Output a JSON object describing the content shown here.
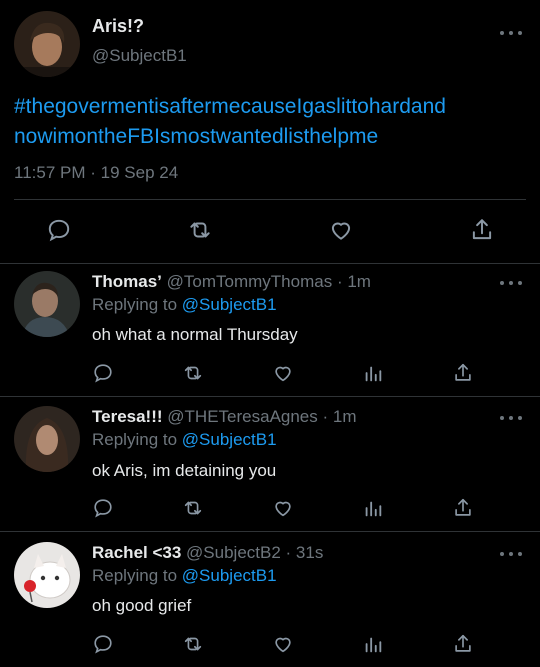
{
  "main_tweet": {
    "display_name": "Aris!?",
    "handle": "@SubjectB1",
    "text_line1": "#thegovermentisaftermecauseIgaslittohardand",
    "text_line2": "nowimontheFBIsmostwantedlisthelpme",
    "time": "11:57 PM",
    "sep": "·",
    "date": "19 Sep 24"
  },
  "replies": [
    {
      "display_name": "Thomas’",
      "handle": "@TomTommyThomas",
      "age": "· 1m",
      "replying_prefix": "Replying to",
      "replying_to": "@SubjectB1",
      "text": "oh what a normal Thursday"
    },
    {
      "display_name": "Teresa!!!",
      "handle": "@THETeresaAgnes",
      "age": "· 1m",
      "replying_prefix": "Replying to",
      "replying_to": "@SubjectB1",
      "text": "ok Aris, im detaining you"
    },
    {
      "display_name": "Rachel <33",
      "handle": "@SubjectB2",
      "age": "· 31s",
      "replying_prefix": "Replying to",
      "replying_to": "@SubjectB1",
      "text": "oh good grief"
    }
  ],
  "icons": [
    "reply-icon",
    "retweet-icon",
    "like-icon",
    "analytics-icon",
    "share-icon",
    "more-icon"
  ],
  "colors": {
    "background": "#000000",
    "text": "#e7e9ea",
    "muted": "#6e767d",
    "accent": "#1d9bf0",
    "divider": "#2f3336"
  }
}
